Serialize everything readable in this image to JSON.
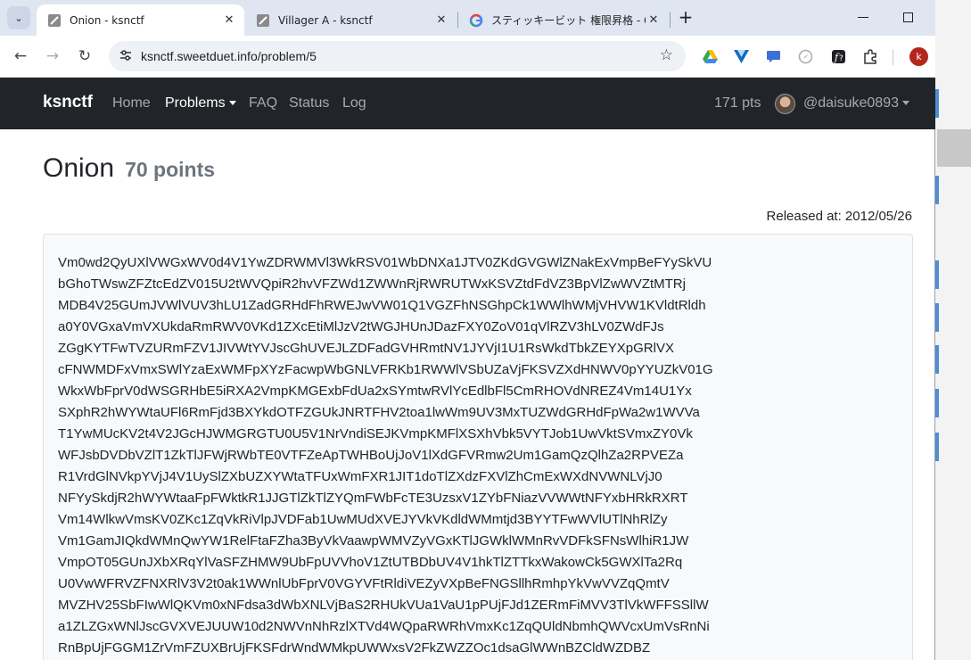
{
  "browser": {
    "tabs": [
      {
        "title": "Onion - ksnctf",
        "favicon": "ksnctf-icon",
        "active": true
      },
      {
        "title": "Villager A - ksnctf",
        "favicon": "ksnctf-icon",
        "active": false
      },
      {
        "title": "スティッキービット 権限昇格 - Goog",
        "favicon": "google-icon",
        "active": false
      }
    ],
    "new_tab": "+",
    "url": "ksnctf.sweetduet.info/problem/5",
    "profile_initial": "k"
  },
  "site": {
    "brand": "ksnctf",
    "nav": [
      "Home",
      "Problems",
      "FAQ",
      "Status",
      "Log"
    ],
    "points": "171 pts",
    "user": "@daisuke0893"
  },
  "problem": {
    "name": "Onion",
    "points": "70 points",
    "released": "Released at: 2012/05/26",
    "lines": [
      "Vm0wd2QyUXlVWGxWV0d4V1YwZDRWMVl3WkRSV01WbDNXa1JTV0ZKdGVGWlZNakExVmpBeFYySkVU",
      "bGhoTWswZFZtcEdZV015U2tWVQpiR2hvVFZWd1ZWWnRjRWRUTWxKSVZtdFdVZ3BpVlZwWVZtMTRj",
      "MDB4V25GUmJVWlVUV3hLU1ZadGRHdFhRWEJwVW01Q1VGZFhNSGhpCk1WWlhWMjVHVW1KVldtRldh",
      "a0Y0VGxaVmVXUkdaRmRWV0VKd1ZXcEtiMlJzV2tWGJHUnJDazFXY0ZoV01qVlRZV3hLV0ZWdFJs",
      "ZGgKYTFwTVZURmFZV1JIVWtYVJscGhUVEJLZDFadGVHRmtNV1JYVjI1U1RsWkdTbkZEYXpGRlVX",
      "cFNWMDFxVmxSWlYzaExWMFpXYzFacwpWbGNLVFRKb1RWWlVSbUZaVjFKSVZXdHNWV0pYYUZkV01G",
      "WkxWbFprV0dWSGRHbE5iRXA2VmpKMGExbFdUa2xSYmtwRVlYcEdlbFl5CmRHOVdNREZ4Vm14U1Yx",
      "SXphR2hWYWtaUFl6RmFjd3BXYkdOTFZGUkJNRTFHV2toa1lwWm9UV3MxTUZWdGRHdFpWa2w1WVVa",
      "T1YwMUcKV2t4V2JGcHJWMGRGTU0U5V1NrVndiSEJKVmpKMFlXSXhVbk5VYTJob1UwVktSVmxZY0Vk",
      "WFJsbDVDbVZlT1ZkTlJFWjRWbTE0VTFZeApTWHBoUjJoV1lXdGFVRmw2Um1GamQzQlhZa2RPVEZa",
      "R1VrdGlNVkpYVjJ4V1UySlZXbUZXYWtaTFUxWmFXR1JIT1doTlZXdzFXVlZhCmExWXdNVWNLVjJ0",
      "NFYySkdjR2hWYWtaaFpFWktkR1JJGTlZkTlZYQmFWbFcTE3UzsxV1ZYbFNiazVVWWtNFYxbHRkRXRT",
      "Vm14WlkwVmsKV0ZKc1ZqVkRiVlpJVDFab1UwMUdXVEJYVkVKdldWMmtjd3BYYTFwWVlUTlNhRlZy",
      "Vm1GamJIQkdWMnQwYW1RelFtaFZha3ByVkVaawpWMVZyVGxKTlJGWklWMnRvVDFkSFNsWlhiR1JW",
      "VmpOT05GUnJXbXRqYlVaSFZHMW9UbFpUVVhoV1ZtUTBDbUV4V1hkTlZTTkxWakowCk5GWXlTa2Rq",
      "U0VwWFRVZFNXRlV3V2t0ak1WWnlUbFprV0VGYVFtRldiVEZyVXpBeFNGSllhRmhpYkVwVVZqQmtV",
      "MVZHV25SbFIwWlQKVm0xNFdsa3dWbXNLVjBaS2RHUkVUa1VaU1pPUjFJd1ZERmFiMVV3TlVkWFFSSllW",
      "a1ZLZGxWNlJscGVXVEJUUW10d2NWVnNhRzlXTVd4WQpaRWRhVmxKc1ZqQUldNbmhQWVcxUmVsRnNi",
      "RnBpUjFGGM1ZrVmFZUXBrUjFKSFdrWndWMkpUWWxsV2FkZWZZOc1dsaGlWWnBZCldWZDBZ"
    ]
  }
}
